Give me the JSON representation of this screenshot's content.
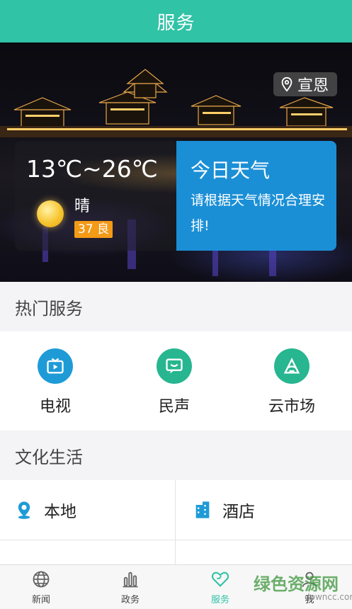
{
  "header": {
    "title": "服务"
  },
  "hero": {
    "location": "宣恩",
    "weather": {
      "temperature": "13℃~26℃",
      "condition": "晴",
      "aqi": "37 良",
      "card_title": "今日天气",
      "card_tip": "请根据天气情况合理安排!"
    }
  },
  "hot_services": {
    "title": "热门服务",
    "items": [
      {
        "label": "电视",
        "icon": "tv-icon"
      },
      {
        "label": "民声",
        "icon": "chat-icon"
      },
      {
        "label": "云市场",
        "icon": "market-icon"
      }
    ]
  },
  "culture": {
    "title": "文化生活",
    "items": [
      {
        "label": "本地",
        "icon": "location-pin-icon"
      },
      {
        "label": "酒店",
        "icon": "hotel-building-icon"
      }
    ]
  },
  "tabbar": {
    "tabs": [
      {
        "label": "新闻",
        "icon": "globe-icon"
      },
      {
        "label": "政务",
        "icon": "bar-chart-icon"
      },
      {
        "label": "服务",
        "icon": "heart-icon"
      },
      {
        "label": "我",
        "icon": "person-icon"
      }
    ],
    "active": "服务"
  },
  "watermark": {
    "text": "绿色资源网",
    "sub": "downcc.com"
  },
  "colors": {
    "brand": "#30c3a6",
    "weather_card": "#1b8fd6",
    "aqi_badge": "#f39a17",
    "icon_blue": "#1e9bd7"
  }
}
